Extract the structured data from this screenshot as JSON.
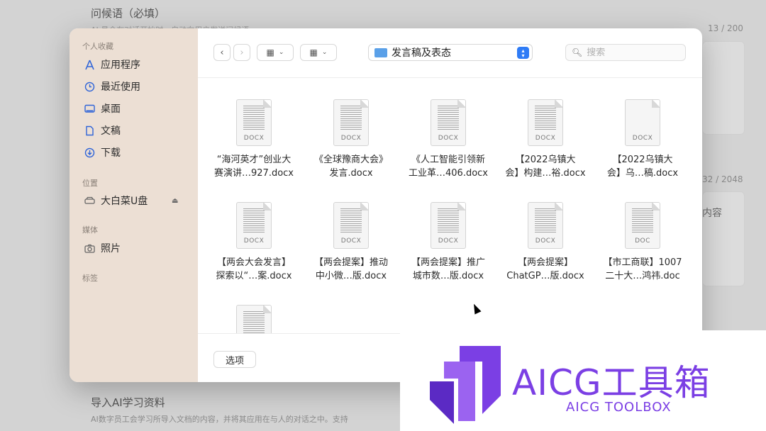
{
  "background": {
    "greeting_title": "问候语（必填）",
    "greeting_hint": "AI 员会在对话开始时，自动向用户发送问候语",
    "greeting_count": "13 / 200",
    "desc_count": "32 / 2048",
    "desc_content_fragment": "内容",
    "import_title": "导入AI学习资料",
    "import_desc": "AI数字员工会学习所导入文档的内容，并将其应用在与人的对话之中。支持"
  },
  "sidebar": {
    "favorites_label": "个人收藏",
    "favorites": [
      {
        "label": "应用程序",
        "icon": "applications-icon"
      },
      {
        "label": "最近使用",
        "icon": "clock-icon"
      },
      {
        "label": "桌面",
        "icon": "desktop-icon"
      },
      {
        "label": "文稿",
        "icon": "document-icon"
      },
      {
        "label": "下载",
        "icon": "download-icon"
      }
    ],
    "locations_label": "位置",
    "locations": [
      {
        "label": "大白菜U盘",
        "icon": "drive-icon"
      }
    ],
    "media_label": "媒体",
    "media": [
      {
        "label": "照片",
        "icon": "camera-icon"
      }
    ],
    "tags_label": "标签"
  },
  "toolbar": {
    "back_icon": "chevron-left-icon",
    "forward_icon": "chevron-right-icon",
    "current_folder": "发言稿及表态",
    "search_placeholder": "搜索"
  },
  "files": [
    {
      "line1": "“海河英才”创业大",
      "line2": "赛演讲…927.docx",
      "ext": "DOCX"
    },
    {
      "line1": "《全球豫商大会》",
      "line2": "发言.docx",
      "ext": "DOCX"
    },
    {
      "line1": "《人工智能引领新",
      "line2": "工业革…406.docx",
      "ext": "DOCX"
    },
    {
      "line1": "【2022乌镇大",
      "line2": "会】构建…裕.docx",
      "ext": "DOCX"
    },
    {
      "line1": "【2022乌镇大",
      "line2": "会】乌…稿.docx",
      "ext": "DOCX"
    },
    {
      "line1": "【两会大会发言】",
      "line2": "探索以“…案.docx",
      "ext": "DOCX"
    },
    {
      "line1": "【两会提案】推动",
      "line2": "中小微…版.docx",
      "ext": "DOCX"
    },
    {
      "line1": "【两会提案】推广",
      "line2": "城市数…版.docx",
      "ext": "DOCX"
    },
    {
      "line1": "【两会提案】",
      "line2": "ChatGP…版.docx",
      "ext": "DOCX"
    },
    {
      "line1": "【市工商联】1007",
      "line2": "二十大…鸿祎.doc",
      "ext": "DOC"
    },
    {
      "line1": "",
      "line2": "",
      "ext": ""
    }
  ],
  "footer": {
    "options_label": "选项"
  },
  "watermark": {
    "title": "AICG工具箱",
    "subtitle": "AICG TOOLBOX",
    "color": "#7b3fe4"
  }
}
